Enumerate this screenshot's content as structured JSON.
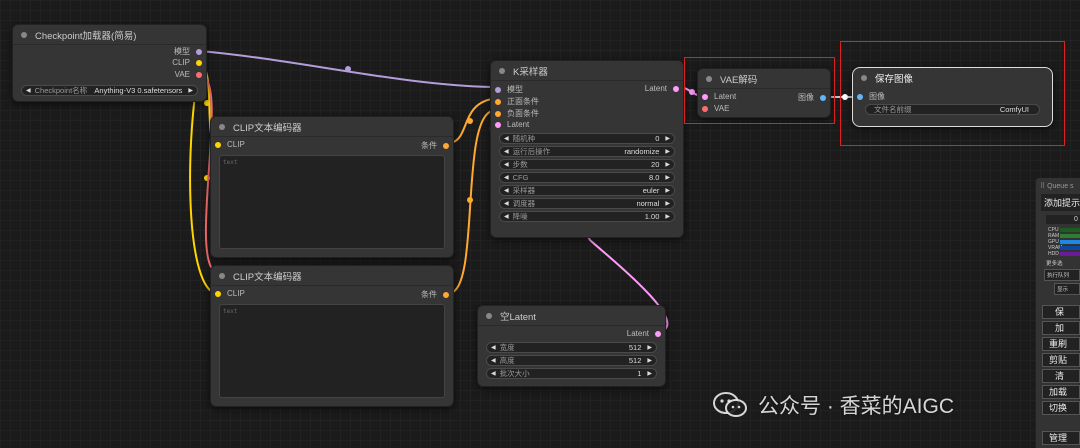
{
  "nodes": {
    "checkpoint": {
      "title": "Checkpoint加载器(简易)",
      "outputs": [
        "模型",
        "CLIP",
        "VAE"
      ],
      "widget": {
        "label": "Checkpoint名称",
        "value": "Anything-V3 0.safetensors"
      }
    },
    "clip1": {
      "title": "CLIP文本编码器",
      "input": "CLIP",
      "output": "条件",
      "placeholder": "text"
    },
    "clip2": {
      "title": "CLIP文本编码器",
      "input": "CLIP",
      "output": "条件",
      "placeholder": "text"
    },
    "ksampler": {
      "title": "K采样器",
      "inputs": [
        "模型",
        "正面条件",
        "负面条件",
        "Latent"
      ],
      "output": "Latent",
      "widgets": [
        {
          "label": "随机种",
          "value": "0"
        },
        {
          "label": "运行后操作",
          "value": "randomize"
        },
        {
          "label": "步数",
          "value": "20"
        },
        {
          "label": "CFG",
          "value": "8.0"
        },
        {
          "label": "采样器",
          "value": "euler"
        },
        {
          "label": "调度器",
          "value": "normal"
        },
        {
          "label": "降噪",
          "value": "1.00"
        }
      ]
    },
    "vae_decode": {
      "title": "VAE解码",
      "inputs": [
        "Latent",
        "VAE"
      ],
      "output": "图像"
    },
    "save_image": {
      "title": "保存图像",
      "input": "图像",
      "widget": {
        "label": "文件名前缀",
        "value": "ComfyUI"
      }
    },
    "empty_latent": {
      "title": "空Latent",
      "output": "Latent",
      "widgets": [
        {
          "label": "宽度",
          "value": "512"
        },
        {
          "label": "高度",
          "value": "512"
        },
        {
          "label": "批次大小",
          "value": "1"
        }
      ]
    }
  },
  "queue_panel": {
    "title": "Queue s",
    "add_prompt": "添加提示",
    "queue_size": "0",
    "stats": [
      "CPU",
      "RAM",
      "GPU",
      "VRAM",
      "HDD"
    ],
    "more_label": "更多选",
    "exec_queue": "执行队列",
    "show": "显示",
    "buttons": [
      "保",
      "加",
      "重刷",
      "剪贴",
      "清",
      "加载",
      "切换",
      "管理"
    ]
  },
  "watermark": "公众号 · 香菜的AIGC",
  "colors": {
    "model": "#b39ddb",
    "clip": "#ffd500",
    "vae": "#ff6e6e",
    "conditioning": "#ffa931",
    "latent": "#ff9cf9",
    "image": "#64b5f6",
    "highlight": "#e02020"
  }
}
